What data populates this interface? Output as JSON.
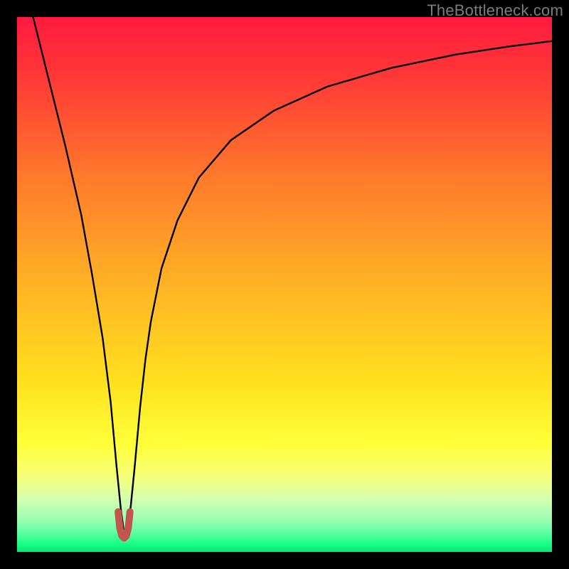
{
  "watermark": "TheBottleneck.com",
  "chart_data": {
    "type": "line",
    "title": "",
    "xlabel": "",
    "ylabel": "",
    "xlim": [
      0,
      100
    ],
    "ylim": [
      0,
      100
    ],
    "grid": false,
    "legend": false,
    "gradient_stops": [
      {
        "offset": 0.0,
        "color": "#ff1a3f"
      },
      {
        "offset": 0.12,
        "color": "#ff3b36"
      },
      {
        "offset": 0.3,
        "color": "#ff7a2b"
      },
      {
        "offset": 0.5,
        "color": "#ffb325"
      },
      {
        "offset": 0.68,
        "color": "#ffe01e"
      },
      {
        "offset": 0.8,
        "color": "#ffff3a"
      },
      {
        "offset": 0.86,
        "color": "#f5ff7a"
      },
      {
        "offset": 0.9,
        "color": "#d6ffb0"
      },
      {
        "offset": 0.94,
        "color": "#9bffb3"
      },
      {
        "offset": 0.965,
        "color": "#5cffa0"
      },
      {
        "offset": 0.985,
        "color": "#1aff84"
      },
      {
        "offset": 1.0,
        "color": "#00e86b"
      }
    ],
    "series": [
      {
        "name": "bottleneck-curve",
        "stroke": "#000000",
        "stroke_width": 2.4,
        "x": [
          3.0,
          6.0,
          9.0,
          12.0,
          14.0,
          16.0,
          17.5,
          18.6,
          19.4,
          20.0,
          20.6,
          21.2,
          22.0,
          23.0,
          24.0,
          25.0,
          27.0,
          30.0,
          34.0,
          40.0,
          48.0,
          58.0,
          70.0,
          82.0,
          92.0,
          100.0
        ],
        "y": [
          100,
          88,
          76,
          63,
          52,
          40,
          28,
          16,
          8,
          3.5,
          3.5,
          8,
          16,
          27,
          36,
          43,
          53,
          62,
          70,
          77,
          82.5,
          87,
          90.5,
          93,
          94.5,
          95.5
        ]
      },
      {
        "name": "valley-marker",
        "stroke": "#c1564f",
        "stroke_width": 10,
        "x": [
          18.9,
          19.2,
          19.6,
          20.0,
          20.4,
          20.8,
          21.1
        ],
        "y": [
          7.5,
          4.5,
          3.0,
          2.6,
          3.0,
          4.5,
          7.5
        ]
      }
    ],
    "annotations": []
  }
}
